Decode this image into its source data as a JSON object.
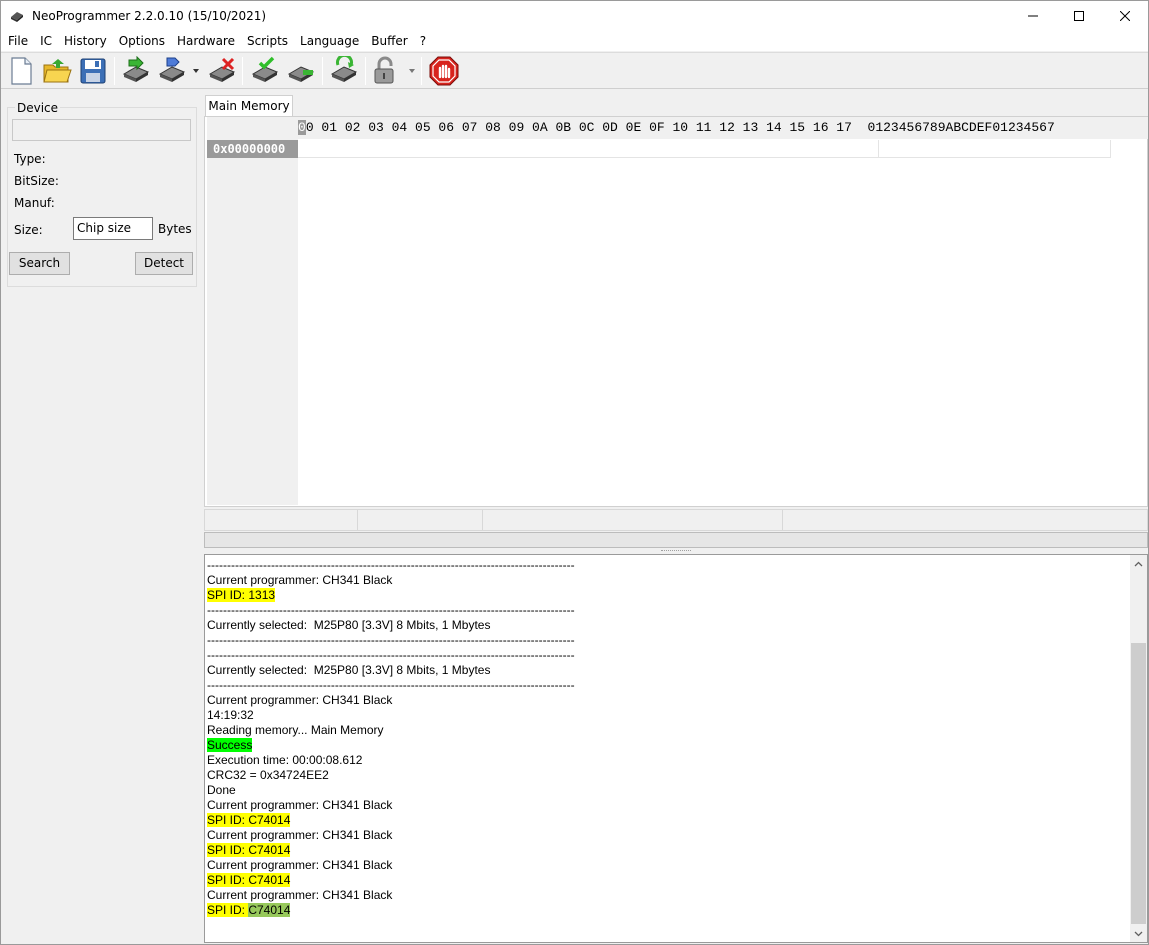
{
  "window": {
    "title": "NeoProgrammer 2.2.0.10 (15/10/2021)"
  },
  "menu": [
    "File",
    "IC",
    "History",
    "Options",
    "Hardware",
    "Scripts",
    "Language",
    "Buffer",
    "?"
  ],
  "toolbar": {
    "icons": [
      "new-file-icon",
      "open-folder-icon",
      "save-disk-icon",
      "read-chip-icon",
      "write-chip-icon",
      "erase-chip-icon",
      "verify-chip-icon",
      "blank-check-icon",
      "auto-program-icon",
      "protect-lock-icon",
      "stop-icon"
    ]
  },
  "device": {
    "group_title": "Device",
    "name_value": "",
    "type_label": "Type:",
    "bitsize_label": "BitSize:",
    "manuf_label": "Manuf:",
    "size_label": "Size:",
    "size_value": "Chip size",
    "bytes_label": "Bytes",
    "search_label": "Search",
    "detect_label": "Detect"
  },
  "tabs": {
    "main_memory": "Main Memory"
  },
  "hex": {
    "cursor_char": "0",
    "header_rest": "0 01 02 03 04 05 06 07 08 09 0A 0B 0C 0D 0E 0F 10 11 12 13 14 15 16 17",
    "ascii_header": "0123456789ABCDEF01234567",
    "address": "0x00000000"
  },
  "log": {
    "divider": "--------------------------------------------------------------------------------------------",
    "lines": [
      {
        "text": "Current programmer: CH341 Black"
      },
      {
        "label": "SPI ID: ",
        "value": "1313"
      },
      {
        "text": "Currently selected:  M25P80 [3.3V] 8 Mbits, 1 Mbytes"
      },
      {
        "text": "Currently selected:  M25P80 [3.3V] 8 Mbits, 1 Mbytes"
      },
      {
        "text": "Current programmer: CH341 Black"
      },
      {
        "text": "14:19:32"
      },
      {
        "text": "Reading memory... Main Memory"
      },
      {
        "text": "Success"
      },
      {
        "text": "Execution time: 00:00:08.612"
      },
      {
        "text": "CRC32 = 0x34724EE2"
      },
      {
        "text": "Done"
      },
      {
        "text": "Current programmer: CH341 Black"
      },
      {
        "label": "SPI ID: ",
        "value": "C74014"
      },
      {
        "text": "Current programmer: CH341 Black"
      },
      {
        "label": "SPI ID: ",
        "value": "C74014"
      },
      {
        "text": "Current programmer: CH341 Black"
      },
      {
        "label": "SPI ID: ",
        "value": "C74014"
      },
      {
        "text": "Current programmer: CH341 Black"
      },
      {
        "label": "SPI ID: ",
        "value": "C74014"
      }
    ]
  },
  "colors": {
    "highlight_yellow": "#ffff00",
    "highlight_green": "#00ff00",
    "highlight_selected": "#97c85b"
  }
}
